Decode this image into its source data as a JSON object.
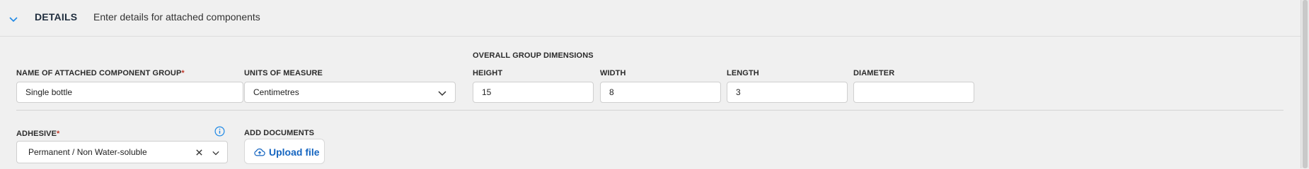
{
  "section": {
    "title": "DETAILS",
    "subtitle": "Enter details for attached components"
  },
  "group_name": {
    "label": "NAME OF ATTACHED COMPONENT GROUP",
    "required_mark": "*",
    "value": "Single bottle"
  },
  "units": {
    "label": "UNITS OF MEASURE",
    "value": "Centimetres"
  },
  "dimensions": {
    "heading": "OVERALL GROUP DIMENSIONS",
    "height": {
      "label": "HEIGHT",
      "value": "15"
    },
    "width": {
      "label": "WIDTH",
      "value": "8"
    },
    "length": {
      "label": "LENGTH",
      "value": "3"
    },
    "diameter": {
      "label": "DIAMETER",
      "value": ""
    }
  },
  "adhesive": {
    "label": "ADHESIVE",
    "required_mark": "*",
    "value": "Permanent / Non Water-soluble",
    "info_icon": "info-icon",
    "clear_icon": "close-icon",
    "dropdown_icon": "chevron-down-icon"
  },
  "documents": {
    "label": "ADD DOCUMENTS",
    "upload_label": "Upload file",
    "upload_icon": "cloud-upload-icon"
  },
  "colors": {
    "background": "#f0f0f0",
    "accent": "#1565c0",
    "required": "#c0392b"
  }
}
